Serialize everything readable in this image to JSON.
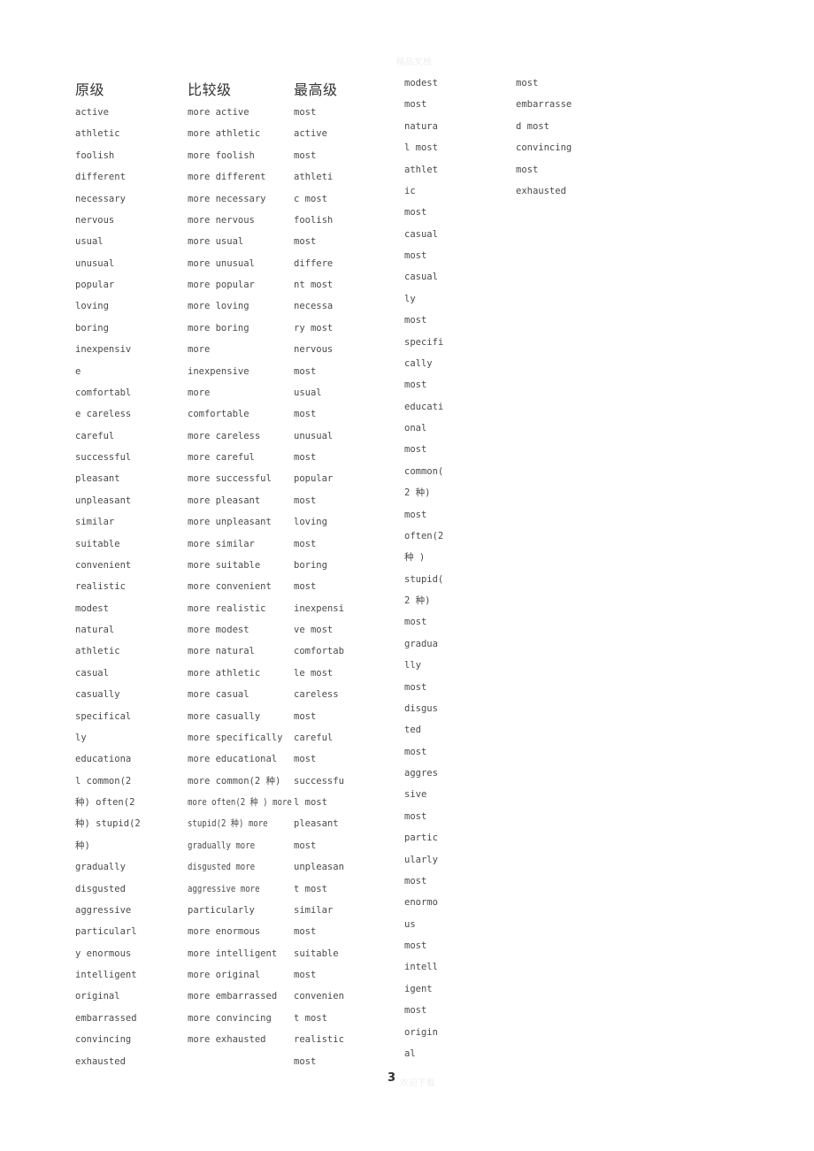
{
  "document": {
    "page_number": "3",
    "watermark_top": "精品文档",
    "watermark_bottom": "欢迎下载"
  },
  "headers": {
    "positive": "原级",
    "comparative": "比较级",
    "superlative": "最高级"
  },
  "columns": {
    "positive": [
      "active",
      "athletic",
      "foolish",
      "different",
      "necessary",
      "nervous",
      "usual",
      "unusual",
      "popular",
      "loving",
      "boring",
      "inexpensiv",
      "e",
      "comfortabl",
      "e careless",
      "careful",
      "successful",
      "pleasant",
      "unpleasant",
      "similar",
      "suitable",
      "convenient",
      "realistic",
      "modest",
      "natural",
      "athletic",
      "casual",
      "casually",
      "specifical",
      "ly",
      "educationa",
      "l common(2",
      "种) often(2",
      "种) stupid(2",
      "种)",
      "gradually",
      "disgusted",
      "aggressive",
      "particularl",
      "y enormous",
      "intelligent",
      "original",
      "embarrassed",
      "convincing",
      "exhausted"
    ],
    "comparative": [
      "more active",
      "more athletic",
      "more foolish",
      "more different",
      "more necessary",
      "more nervous",
      "more usual",
      "more unusual",
      "more popular",
      "more loving",
      "more boring",
      "more",
      "inexpensive",
      "more",
      "comfortable",
      "more careless",
      "more careful",
      "more successful",
      "more pleasant",
      "more unpleasant",
      "more similar",
      "more suitable",
      "more convenient",
      "more realistic",
      "more modest",
      "more natural",
      "more athletic",
      "more casual",
      "more casually",
      "more specifically",
      "more educational",
      "more common(2 种)",
      "more often(2 种 ) more",
      "stupid(2 种) more",
      "gradually more",
      "disgusted more",
      "aggressive more",
      "particularly",
      "more enormous",
      "more intelligent",
      "more original",
      "more embarrassed",
      "more convincing",
      "more exhausted"
    ],
    "comparative_condensed_indices": [
      32,
      33,
      34,
      35,
      36
    ],
    "superlative": [
      "most",
      "active",
      "most",
      "athleti",
      "c most",
      "foolish",
      "most",
      "differe",
      "nt most",
      "necessa",
      "ry most",
      "nervous",
      "most",
      "usual",
      "most",
      "unusual",
      "most",
      "popular",
      "most",
      "loving",
      "most",
      "boring",
      "most",
      "inexpensi",
      "ve most",
      "comfortab",
      "le most",
      "careless",
      "most",
      "careful",
      "most",
      "successfu",
      "l most",
      "pleasant",
      "most",
      "unpleasan",
      "t most",
      "similar",
      "most",
      "suitable",
      "most",
      "convenien",
      "t most",
      "realistic",
      "most"
    ],
    "overflow_a": [
      "modest",
      "most",
      "natura",
      "l most",
      "athlet",
      "ic",
      "most",
      "casual",
      "most",
      "casual",
      "ly",
      "most",
      "specifi",
      "cally",
      "most",
      "educati",
      "onal",
      "most",
      "common(",
      "2 种)",
      "most",
      "often(2",
      "种 )",
      "stupid(",
      "2 种)",
      "most",
      "gradua",
      "lly",
      "most",
      "disgus",
      "ted",
      "most",
      "aggres",
      "sive",
      "most",
      "partic",
      "ularly",
      "most",
      "enormo",
      "us",
      "most",
      "intell",
      "igent",
      "most",
      "origin",
      "al"
    ],
    "overflow_b": [
      "most",
      "embarrasse",
      "d most",
      "convincing",
      "most",
      "exhausted"
    ]
  }
}
